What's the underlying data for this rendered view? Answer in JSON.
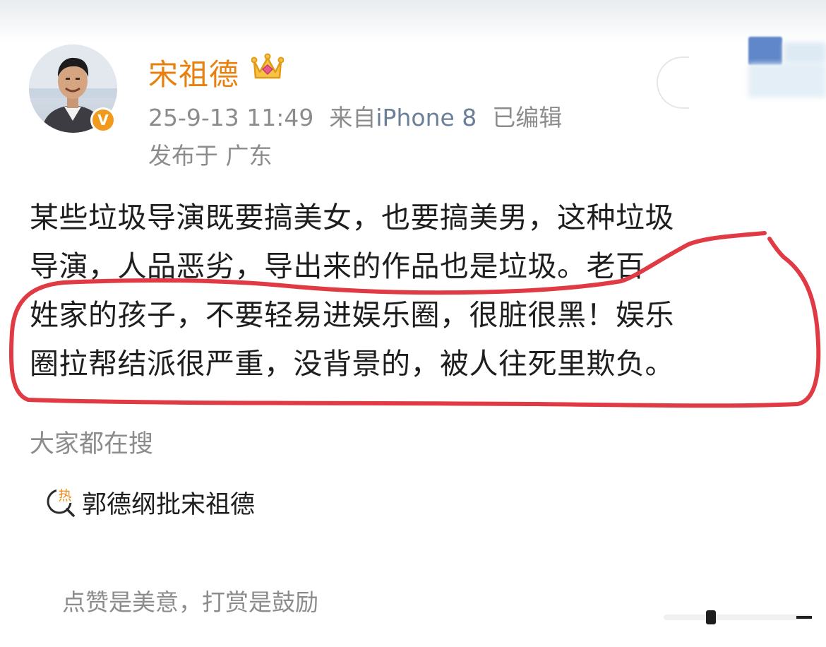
{
  "author": {
    "name": "宋祖德",
    "crown_icon": "crown-icon",
    "verified_badge": "V"
  },
  "post_meta": {
    "time": "25-9-13 11:49",
    "source_label": "来自",
    "device": "iPhone 8",
    "edited": "已编辑",
    "location": "发布于 广东"
  },
  "post": {
    "lines": [
      "某些垃圾导演既要搞美女，也要搞美男，这种垃圾",
      "导演，人品恶劣，导出来的作品也是垃圾。老百",
      "姓家的孩子，不要轻易进娱乐圈，很脏很黑！娱乐",
      "圈拉帮结派很严重，没背景的，被人往死里欺负。"
    ]
  },
  "search": {
    "title": "大家都在搜",
    "hot_icon_label": "热",
    "items": [
      "郭德纲批宋祖德"
    ]
  },
  "footer": {
    "reward_text": "点赞是美意，打赏是鼓励"
  },
  "colors": {
    "username": "#e8800f",
    "badge": "#f29a1d",
    "annotation": "#e03a44",
    "meta": "#8c8c8c"
  }
}
